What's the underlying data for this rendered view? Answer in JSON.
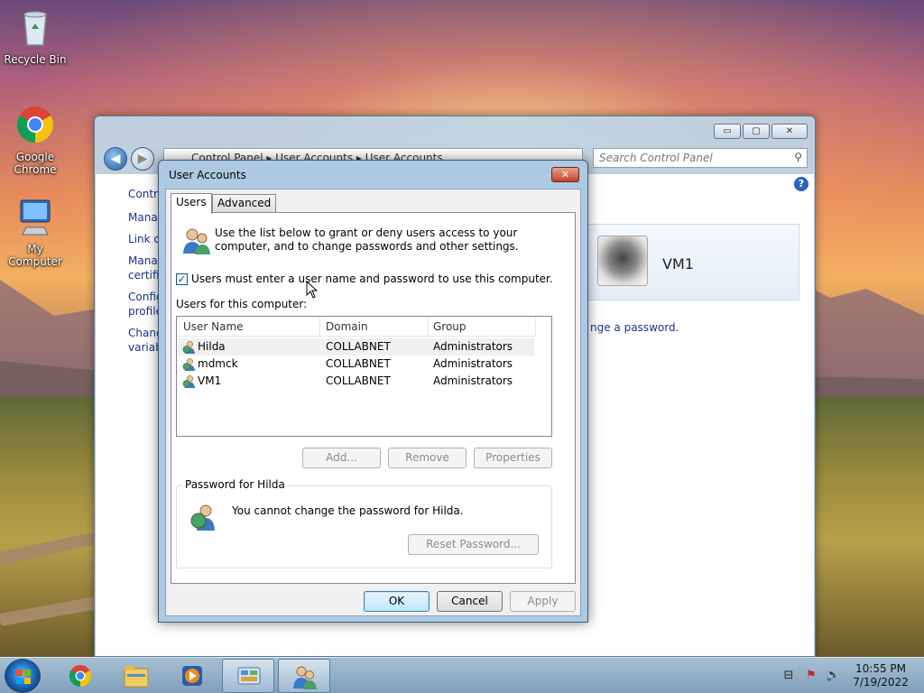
{
  "desktop": {
    "icons": [
      {
        "label": "Recycle Bin",
        "icon": "recycle-bin-icon"
      },
      {
        "label": "Google Chrome",
        "icon": "chrome-icon"
      },
      {
        "label": "My Computer",
        "icon": "computer-icon"
      }
    ]
  },
  "control_panel": {
    "address": "Control Panel  ▸  User Accounts  ▸  User Accounts",
    "search_placeholder": "Search Control Panel",
    "side_links": [
      "Contro",
      "Manag",
      "Link o",
      "Manag certifi",
      "Config profile",
      "Chang variab"
    ],
    "user_name": "VM1",
    "password_link": "nge a password.",
    "controls": {
      "minimize": "▭",
      "maximize": "▢",
      "close": "✕"
    }
  },
  "dialog": {
    "title": "User Accounts",
    "close_label": "✕",
    "tabs": [
      {
        "label": "Users",
        "active": true
      },
      {
        "label": "Advanced",
        "active": false
      }
    ],
    "intro": "Use the list below to grant or deny users access to your computer, and to change passwords and other settings.",
    "checkbox": {
      "label": "Users must enter a user name and password to use this computer.",
      "checked": true,
      "mark": "✓"
    },
    "users_label": "Users for this computer:",
    "columns": [
      "User Name",
      "Domain",
      "Group"
    ],
    "rows": [
      {
        "name": "Hilda",
        "domain": "COLLABNET",
        "group": "Administrators",
        "selected": true
      },
      {
        "name": "mdmck",
        "domain": "COLLABNET",
        "group": "Administrators",
        "selected": false
      },
      {
        "name": "VM1",
        "domain": "COLLABNET",
        "group": "Administrators",
        "selected": false
      }
    ],
    "buttons": {
      "add": "Add...",
      "remove": "Remove",
      "properties": "Properties"
    },
    "password_group": {
      "title": "Password for Hilda",
      "text": "You cannot change the password for Hilda.",
      "reset_button": "Reset Password..."
    },
    "footer": {
      "ok": "OK",
      "cancel": "Cancel",
      "apply": "Apply"
    }
  },
  "taskbar": {
    "items": [
      "chrome-icon",
      "explorer-icon",
      "media-player-icon",
      "control-panel-icon",
      "user-accounts-icon"
    ],
    "clock": {
      "time": "10:55 PM",
      "date": "7/19/2022"
    }
  }
}
